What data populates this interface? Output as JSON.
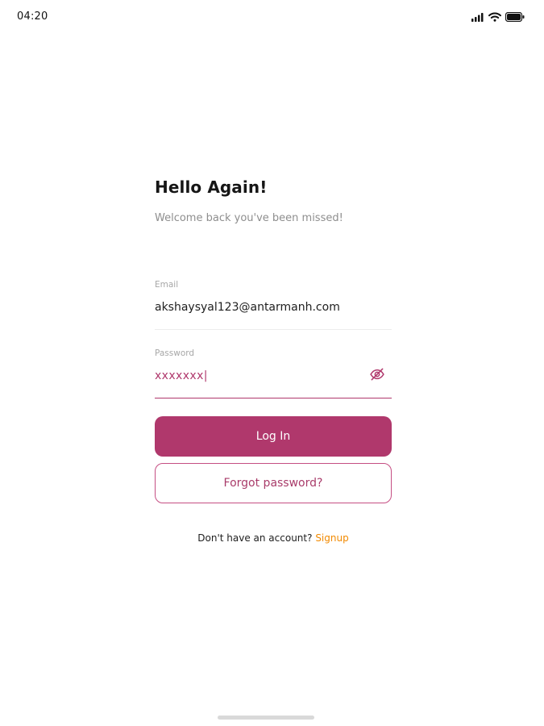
{
  "status_bar": {
    "time": "04:20",
    "icons": [
      "signal-icon",
      "wifi-icon",
      "battery-icon"
    ]
  },
  "login": {
    "title": "Hello Again!",
    "subtitle": "Welcome back you've been missed!",
    "email": {
      "label": "Email",
      "value": "akshaysyal123@antarmanh.com"
    },
    "password": {
      "label": "Password",
      "value": "xxxxxxx",
      "caret": "|",
      "toggle_icon": "eye-off-icon"
    },
    "login_button_label": "Log In",
    "forgot_button_label": "Forgot password?",
    "signup_prompt": "Don't have an account?",
    "signup_link": "Signup"
  },
  "colors": {
    "primary": "#b0386c",
    "accent": "#f28a00",
    "text": "#202020",
    "muted": "#8e8e8e"
  }
}
